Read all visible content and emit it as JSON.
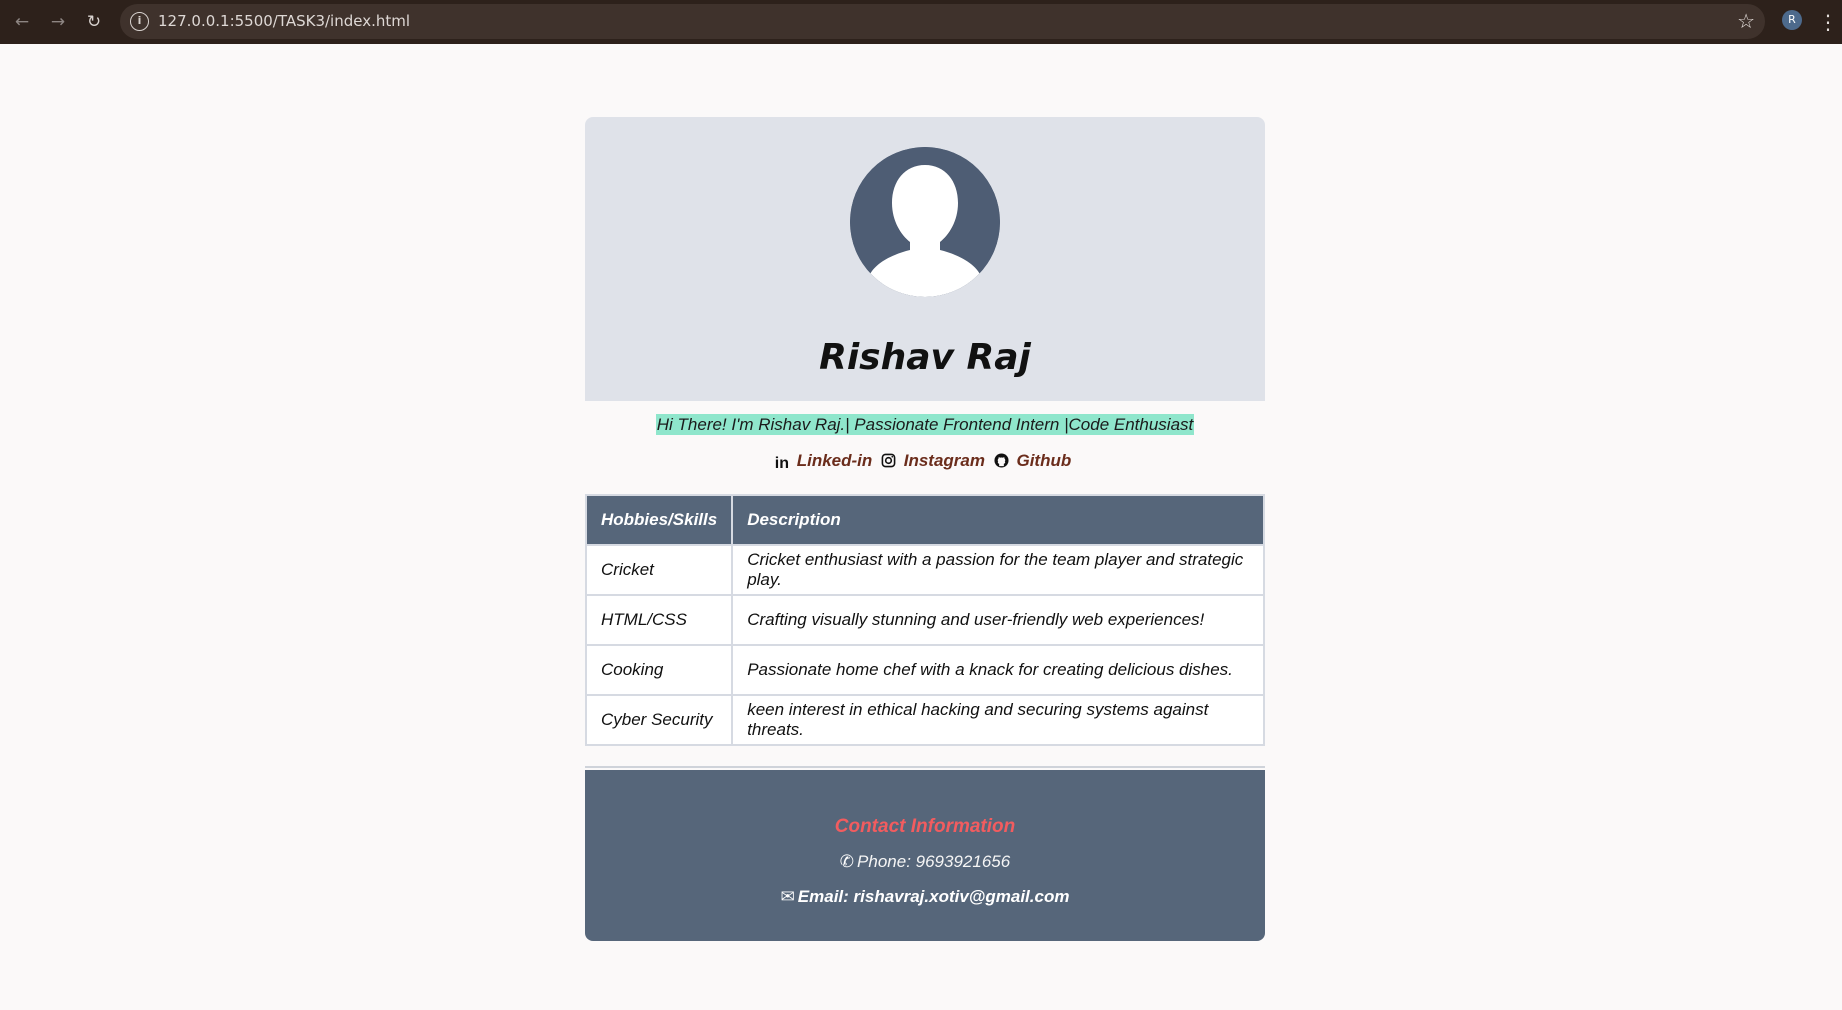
{
  "browser": {
    "url": "127.0.0.1:5500/TASK3/index.html",
    "profile_initial": "R"
  },
  "profile": {
    "name": "Rishav Raj",
    "tagline": "Hi There! I'm Rishav Raj.| Passionate Frontend Intern |Code Enthusiast"
  },
  "links": [
    {
      "icon": "linkedin-icon",
      "label": "Linked-in"
    },
    {
      "icon": "instagram-icon",
      "label": "Instagram"
    },
    {
      "icon": "github-icon",
      "label": "Github"
    }
  ],
  "skills_table": {
    "headers": [
      "Hobbies/Skills",
      "Description"
    ],
    "rows": [
      [
        "Cricket",
        "Cricket enthusiast with a passion for the team player and strategic play."
      ],
      [
        "HTML/CSS",
        "Crafting visually stunning and user-friendly web experiences!"
      ],
      [
        "Cooking",
        "Passionate home chef with a knack for creating delicious dishes."
      ],
      [
        "Cyber Security",
        "keen interest in ethical hacking and securing systems against threats."
      ]
    ]
  },
  "contact": {
    "title": "Contact Information",
    "phone": "Phone: 9693921656",
    "email": "Email: rishavraj.xotiv@gmail.com"
  },
  "colors": {
    "header_bg": "#dfe2e9",
    "table_header_bg": "#56667a",
    "tagline_highlight": "#8fe6cc",
    "link_color": "#6b2d1c",
    "contact_title": "#f25c5f"
  }
}
